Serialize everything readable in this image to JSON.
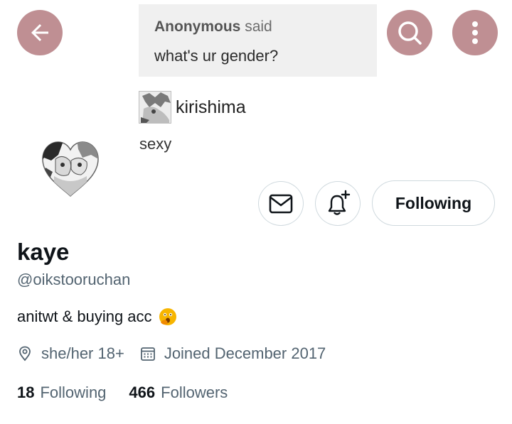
{
  "header": {
    "back_icon": "arrow-left-icon",
    "search_icon": "search-icon",
    "more_icon": "more-vertical-icon",
    "button_color": "#bf8f93"
  },
  "banner": {
    "ask_author": "Anonymous",
    "ask_verb": "said",
    "ask_question": "what's ur gender?",
    "answerer_name": "kirishima",
    "answer": "sexy"
  },
  "profile": {
    "display_name": "kaye",
    "handle": "@oikstooruchan",
    "bio": "anitwt & buying acc",
    "bio_emoji": "face-with-open-eyes-and-hand-over-mouth",
    "location_icon": "location-pin-icon",
    "location": "she/her 18+",
    "calendar_icon": "calendar-icon",
    "joined": "Joined December 2017"
  },
  "actions": {
    "message_icon": "envelope-icon",
    "notify_icon": "bell-plus-icon",
    "follow_label": "Following"
  },
  "stats": {
    "following_count": "18",
    "following_label": "Following",
    "followers_count": "466",
    "followers_label": "Followers"
  }
}
